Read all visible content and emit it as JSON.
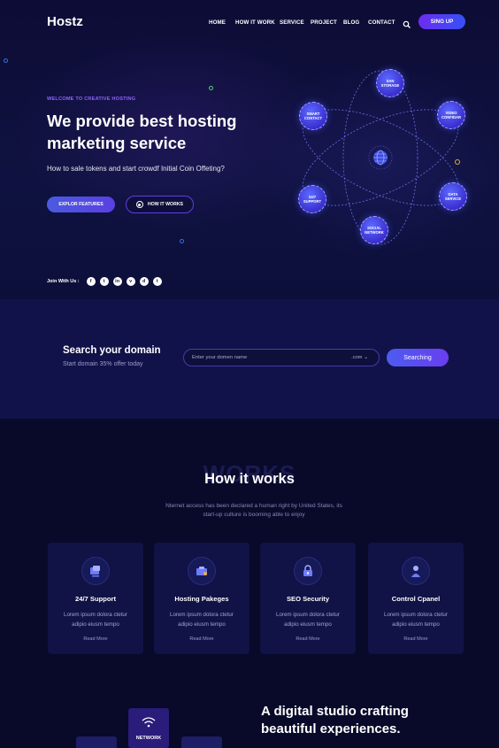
{
  "header": {
    "logo": "Hostz",
    "nav": [
      "HOME",
      "HOW IT WORK",
      "SERVICE",
      "PROJECT",
      "BLOG",
      "CONTACT"
    ],
    "signup_label": "SING UP",
    "search_icon": "search-icon"
  },
  "hero": {
    "eyebrow": "WELCOME TO CREATIVE HOSTING",
    "headline_line1": "We provide best hosting",
    "headline_line2": "marketing service",
    "subtext": "How to sale tokens and start crowdf Initial Coin Offeting?",
    "explore_label": "EXPLOR FEATURES",
    "how_label": "HOW IT WORKS",
    "join_label": "Join With Us :",
    "social": [
      {
        "icon": "facebook-icon",
        "glyph": "f"
      },
      {
        "icon": "twitter-icon",
        "glyph": "t"
      },
      {
        "icon": "linkedin-icon",
        "glyph": "in"
      },
      {
        "icon": "vimeo-icon",
        "glyph": "v"
      },
      {
        "icon": "dribbble-icon",
        "glyph": "d"
      },
      {
        "icon": "tumblr-icon",
        "glyph": "t"
      }
    ]
  },
  "diagram": {
    "nodes": [
      "SAN STORAGE",
      "SMART CONTACT",
      "VIDEO CONFIDAR",
      "24/7 SUPPORT",
      "DATA SERVICE",
      "SOCIAL NETWORK"
    ]
  },
  "domain": {
    "title": "Search your domain",
    "subtitle": "Start domain 35% offer today",
    "placeholder": "Enter your domen name",
    "tld": ".com",
    "button": "Searching"
  },
  "works": {
    "bg_text": "WORKS",
    "title": "How it works",
    "desc_line1": "Nternet access has been declared a human right by United States, its",
    "desc_line2": "start-up culture is booming able to enjoy",
    "cards": [
      {
        "title": "24/7 Support",
        "desc1": "Lorem ipsum dolora ctetur",
        "desc2": "adipio eiusm tempo",
        "link": "Read More",
        "icon": "support-icon"
      },
      {
        "title": "Hosting Pakeges",
        "desc1": "Lorem ipsum dolora ctetur",
        "desc2": "adipio eiusm tempo",
        "link": "Read More",
        "icon": "package-icon"
      },
      {
        "title": "SEO Security",
        "desc1": "Lorem ipsum dolora ctetur",
        "desc2": "adipio eiusm tempo",
        "link": "Read More",
        "icon": "lock-icon"
      },
      {
        "title": "Control Cpanel",
        "desc1": "Lorem ipsum dolora ctetur",
        "desc2": "adipio eiusm tempo",
        "link": "Read More",
        "icon": "user-icon"
      }
    ]
  },
  "studio": {
    "line1": "A digital studio crafting",
    "line2": "beautiful experiences.",
    "network_label": "NETWORK"
  },
  "colors": {
    "background": "#0a0b2e",
    "accent_purple": "#6d2cf0",
    "accent_blue": "#3551f5",
    "eyebrow": "#8e63ff"
  }
}
